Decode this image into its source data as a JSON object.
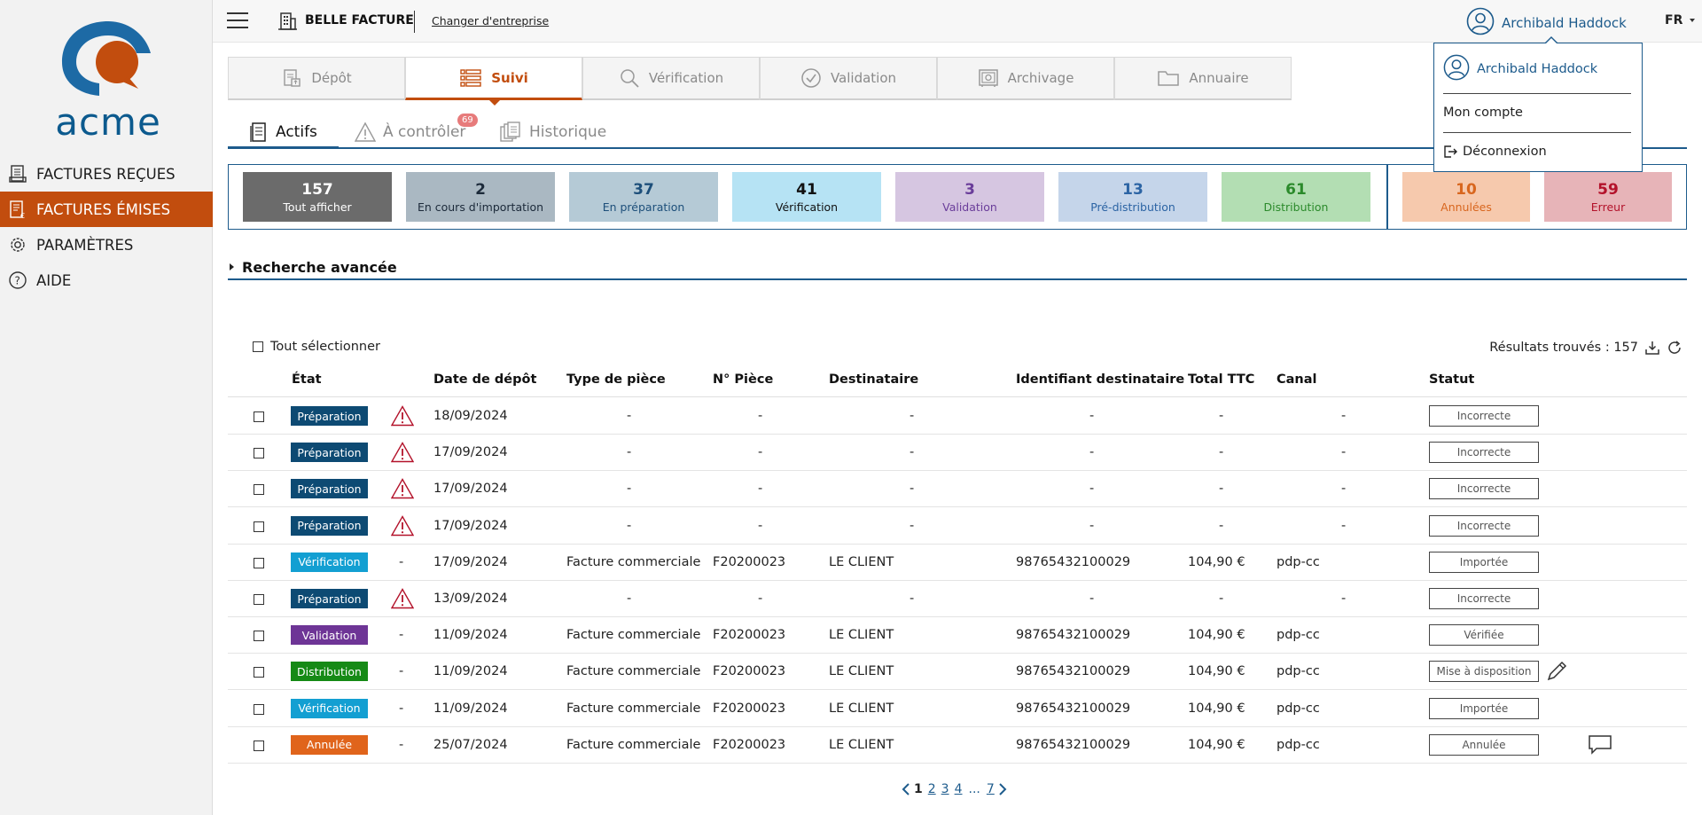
{
  "brand": {
    "name": "acme",
    "primary": "#c24d0e",
    "blue": "#0c5a8e"
  },
  "sidebar": {
    "items": [
      {
        "label": "FACTURES REÇUES",
        "icon": "received-invoices-icon",
        "active": false
      },
      {
        "label": "FACTURES ÉMISES",
        "icon": "issued-invoices-icon",
        "active": true
      },
      {
        "label": "PARAMÈTRES",
        "icon": "gear-icon",
        "active": false
      },
      {
        "label": "AIDE",
        "icon": "help-icon",
        "active": false
      }
    ]
  },
  "topbar": {
    "company": "BELLE FACTURE",
    "change_company": "Changer d'entreprise",
    "user": "Archibald Haddock",
    "lang": "FR"
  },
  "user_menu": {
    "user": "Archibald Haddock",
    "account": "Mon compte",
    "logout": "Déconnexion"
  },
  "main_tabs": [
    {
      "label": "Dépôt",
      "icon": "upload-document-icon",
      "active": false
    },
    {
      "label": "Suivi",
      "icon": "list-icon",
      "active": true
    },
    {
      "label": "Vérification",
      "icon": "search-icon",
      "active": false
    },
    {
      "label": "Validation",
      "icon": "check-circle-icon",
      "active": false
    },
    {
      "label": "Archivage",
      "icon": "safe-icon",
      "active": false
    },
    {
      "label": "Annuaire",
      "icon": "folder-icon",
      "active": false
    }
  ],
  "sub_tabs": {
    "actifs": "Actifs",
    "a_controler": "À contrôler",
    "a_controler_count": "69",
    "historique": "Historique"
  },
  "status_cards": [
    {
      "num": "157",
      "label": "Tout afficher",
      "bg": "#6b6b6b",
      "fg": "#ffffff"
    },
    {
      "num": "2",
      "label": "En cours d'importation",
      "bg": "#aab8c2",
      "fg": "#1c2a3a"
    },
    {
      "num": "37",
      "label": "En préparation",
      "bg": "#b5cad6",
      "fg": "#1d4f7a"
    },
    {
      "num": "41",
      "label": "Vérification",
      "bg": "#b6e3f4",
      "fg": "#111111"
    },
    {
      "num": "3",
      "label": "Validation",
      "bg": "#d6c6e1",
      "fg": "#6a3d9a"
    },
    {
      "num": "13",
      "label": "Pré-distribution",
      "bg": "#c5d5ea",
      "fg": "#2c64a4"
    },
    {
      "num": "61",
      "label": "Distribution",
      "bg": "#b3deb3",
      "fg": "#2b8a2b"
    },
    {
      "num": "10",
      "label": "Annulées",
      "bg": "#f6c9ad",
      "fg": "#d8661e"
    },
    {
      "num": "59",
      "label": "Erreur",
      "bg": "#e7b4b8",
      "fg": "#b3122a"
    }
  ],
  "advanced_search": "Recherche avancée",
  "select_all": "Tout sélectionner",
  "results": "Résultats trouvés : 157",
  "columns": {
    "etat": "État",
    "date": "Date de dépôt",
    "type": "Type de pièce",
    "numero": "N° Pièce",
    "destinataire": "Destinataire",
    "identifiant": "Identifiant destinataire",
    "total": "Total TTC",
    "canal": "Canal",
    "statut": "Statut"
  },
  "rows": [
    {
      "etat": "Préparation",
      "etat_color": "#0d4a73",
      "warn": true,
      "date": "18/09/2024",
      "type": "-",
      "numero": "-",
      "destinataire": "-",
      "identifiant": "-",
      "total": "-",
      "canal": "-",
      "statut": "Incorrecte",
      "action": ""
    },
    {
      "etat": "Préparation",
      "etat_color": "#0d4a73",
      "warn": true,
      "date": "17/09/2024",
      "type": "-",
      "numero": "-",
      "destinataire": "-",
      "identifiant": "-",
      "total": "-",
      "canal": "-",
      "statut": "Incorrecte",
      "action": ""
    },
    {
      "etat": "Préparation",
      "etat_color": "#0d4a73",
      "warn": true,
      "date": "17/09/2024",
      "type": "-",
      "numero": "-",
      "destinataire": "-",
      "identifiant": "-",
      "total": "-",
      "canal": "-",
      "statut": "Incorrecte",
      "action": ""
    },
    {
      "etat": "Préparation",
      "etat_color": "#0d4a73",
      "warn": true,
      "date": "17/09/2024",
      "type": "-",
      "numero": "-",
      "destinataire": "-",
      "identifiant": "-",
      "total": "-",
      "canal": "-",
      "statut": "Incorrecte",
      "action": ""
    },
    {
      "etat": "Vérification",
      "etat_color": "#139fd2",
      "warn": false,
      "date": "17/09/2024",
      "type": "Facture commerciale",
      "numero": "F20200023",
      "destinataire": "LE CLIENT",
      "identifiant": "98765432100029",
      "total": "104,90 €",
      "canal": "pdp-cc",
      "statut": "Importée",
      "action": ""
    },
    {
      "etat": "Préparation",
      "etat_color": "#0d4a73",
      "warn": true,
      "date": "13/09/2024",
      "type": "-",
      "numero": "-",
      "destinataire": "-",
      "identifiant": "-",
      "total": "-",
      "canal": "-",
      "statut": "Incorrecte",
      "action": ""
    },
    {
      "etat": "Validation",
      "etat_color": "#6e3596",
      "warn": false,
      "date": "11/09/2024",
      "type": "Facture commerciale",
      "numero": "F20200023",
      "destinataire": "LE CLIENT",
      "identifiant": "98765432100029",
      "total": "104,90 €",
      "canal": "pdp-cc",
      "statut": "Vérifiée",
      "action": ""
    },
    {
      "etat": "Distribution",
      "etat_color": "#168a16",
      "warn": false,
      "date": "11/09/2024",
      "type": "Facture commerciale",
      "numero": "F20200023",
      "destinataire": "LE CLIENT",
      "identifiant": "98765432100029",
      "total": "104,90 €",
      "canal": "pdp-cc",
      "statut": "Mise à disposition",
      "action": "pencil-icon"
    },
    {
      "etat": "Vérification",
      "etat_color": "#139fd2",
      "warn": false,
      "date": "11/09/2024",
      "type": "Facture commerciale",
      "numero": "F20200023",
      "destinataire": "LE CLIENT",
      "identifiant": "98765432100029",
      "total": "104,90 €",
      "canal": "pdp-cc",
      "statut": "Importée",
      "action": ""
    },
    {
      "etat": "Annulée",
      "etat_color": "#e0641b",
      "warn": false,
      "date": "25/07/2024",
      "type": "Facture commerciale",
      "numero": "F20200023",
      "destinataire": "LE CLIENT",
      "identifiant": "98765432100029",
      "total": "104,90 €",
      "canal": "pdp-cc",
      "statut": "Annulée",
      "action": "comment-icon"
    }
  ],
  "pagination": {
    "pages": [
      "1",
      "2",
      "3",
      "4"
    ],
    "ellipsis": "...",
    "last": "7",
    "current": "1"
  }
}
